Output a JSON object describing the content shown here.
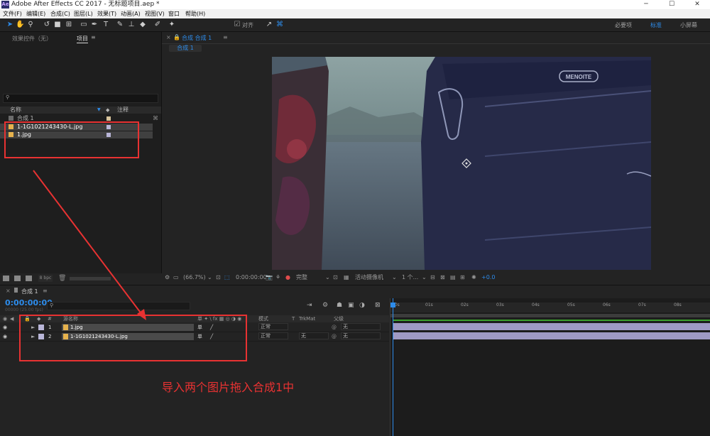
{
  "window": {
    "title": "Adobe After Effects CC 2017 - 无标题项目.aep *",
    "app_icon": "Ae"
  },
  "menu": [
    "文件(F)",
    "编辑(E)",
    "合成(C)",
    "图层(L)",
    "效果(T)",
    "动画(A)",
    "视图(V)",
    "窗口",
    "帮助(H)"
  ],
  "toolbar": {
    "snap_label": "对齐",
    "workspaces": [
      "必要项",
      "标准",
      "小屏幕"
    ],
    "active_workspace": "标准"
  },
  "project_panel": {
    "tabs": [
      "效果控件（无）",
      "项目"
    ],
    "active_tab": "项目",
    "columns": {
      "name": "名称",
      "comment": "注释"
    },
    "items": [
      {
        "name": "合成 1",
        "type": "comp",
        "label_color": "#d7c39b"
      },
      {
        "name": "1-1G1021243430-L.jpg",
        "type": "image",
        "label_color": "#b9b6d8"
      },
      {
        "name": "1.jpg",
        "type": "image",
        "label_color": "#b9b6d8"
      }
    ],
    "bpc": "8 bpc"
  },
  "viewer": {
    "tab_label": "合成 合成 1",
    "breadcrumb": "合成 1",
    "suitcase_brand": "MENOITE",
    "controls": {
      "zoom": "(66.7%)",
      "timecode": "0:00:00:00",
      "resolution": "完整",
      "camera": "活动摄像机",
      "views": "1 个...",
      "exposure": "+0.0"
    }
  },
  "timeline": {
    "tab": "合成 1",
    "timecode": "0:00:00:00",
    "fps": "00000 (25.00 fps)",
    "columns": {
      "num": "#",
      "source": "源名称",
      "mode": "模式",
      "t": "T",
      "trkmat": "TrkMat",
      "parent": "父级"
    },
    "layers": [
      {
        "num": "1",
        "name": "1.jpg",
        "mode": "正常",
        "trkmat": "",
        "parent": "无"
      },
      {
        "num": "2",
        "name": "1-1G1021243430-L.jpg",
        "mode": "正常",
        "trkmat": "无",
        "parent": "无"
      }
    ],
    "ruler": [
      "00s",
      "01s",
      "02s",
      "03s",
      "04s",
      "05s",
      "06s",
      "07s",
      "08s"
    ]
  },
  "annotation": {
    "text": "导入两个图片拖入合成1中",
    "color": "#e83232"
  }
}
